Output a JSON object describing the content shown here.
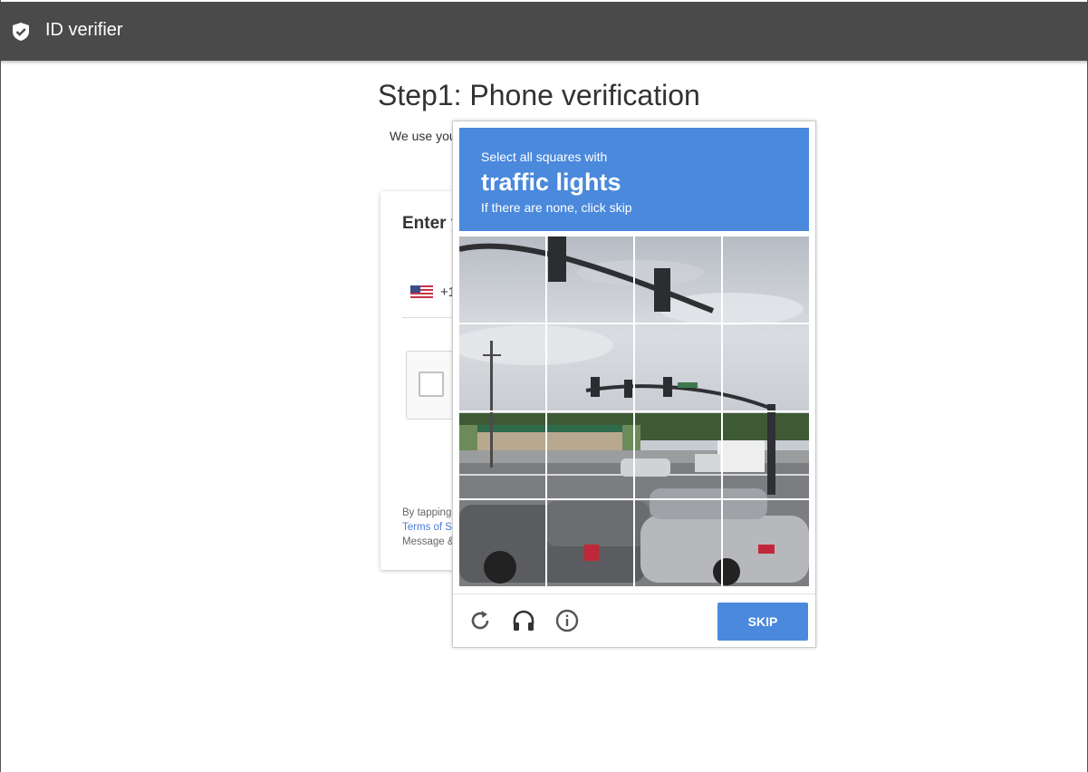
{
  "app": {
    "title": "ID verifier"
  },
  "page": {
    "title": "Step1: Phone verification",
    "intro": "We use you"
  },
  "card": {
    "title": "Enter y",
    "dial_code": "+1",
    "legal_line1": "By tapping",
    "legal_link": "Terms of S",
    "legal_line3": "Message &"
  },
  "captcha": {
    "instruction": "Select all squares with",
    "target": "traffic lights",
    "hint": "If there are none, click skip",
    "skip_label": "SKIP",
    "grid": {
      "rows": 4,
      "cols": 4
    }
  },
  "icons": {
    "logo": "shield-check-icon",
    "flag": "us-flag-icon",
    "reload": "reload-icon",
    "audio": "headphones-icon",
    "info": "info-icon"
  },
  "colors": {
    "topbar": "#4a4a4a",
    "accent": "#4a89dc",
    "link": "#4a7bd6"
  }
}
